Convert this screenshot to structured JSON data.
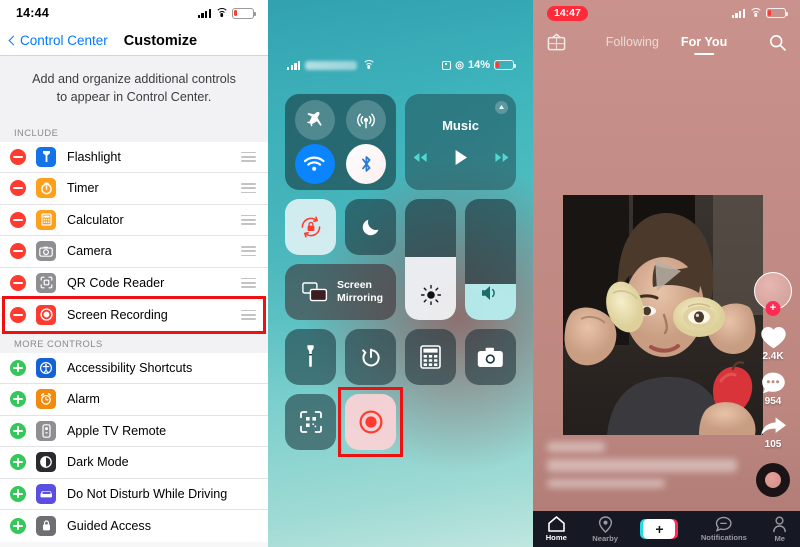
{
  "settings_panel": {
    "status_bar": {
      "time": "14:44",
      "battery_level_pct": 14,
      "signal_icon": "signal-bars-icon",
      "wifi_icon": "wifi-icon",
      "battery_icon": "battery-low-icon"
    },
    "nav": {
      "back_label": "Control Center",
      "title": "Customize",
      "back_icon": "chevron-left-icon"
    },
    "description": "Add and organize additional controls to appear in Control Center.",
    "include_header": "INCLUDE",
    "more_header": "MORE CONTROLS",
    "include_items": [
      {
        "label": "Flashlight",
        "icon": "flashlight-icon",
        "icon_color": "#1473e6",
        "glyph": "▌",
        "action_icon": "remove-icon",
        "highlighted": false
      },
      {
        "label": "Timer",
        "icon": "timer-icon",
        "icon_color": "#ffa01c",
        "glyph": "◴",
        "action_icon": "remove-icon",
        "highlighted": false
      },
      {
        "label": "Calculator",
        "icon": "calculator-icon",
        "icon_color": "#ffa01c",
        "glyph": "⌸",
        "action_icon": "remove-icon",
        "highlighted": false
      },
      {
        "label": "Camera",
        "icon": "camera-icon",
        "icon_color": "#8e8e93",
        "glyph": "◎",
        "action_icon": "remove-icon",
        "highlighted": false
      },
      {
        "label": "QR Code Reader",
        "icon": "qr-code-icon",
        "icon_color": "#8e8e93",
        "glyph": "⬚",
        "action_icon": "remove-icon",
        "highlighted": false
      },
      {
        "label": "Screen Recording",
        "icon": "record-icon",
        "icon_color": "#ff3b30",
        "glyph": "◉",
        "action_icon": "remove-icon",
        "highlighted": true
      }
    ],
    "more_items": [
      {
        "label": "Accessibility Shortcuts",
        "icon": "accessibility-icon",
        "icon_color": "#1463d6",
        "glyph": "Ⓙ",
        "action_icon": "add-icon"
      },
      {
        "label": "Alarm",
        "icon": "alarm-clock-icon",
        "icon_color": "#f28a0d",
        "glyph": "⏰",
        "action_icon": "add-icon"
      },
      {
        "label": "Apple TV Remote",
        "icon": "tv-remote-icon",
        "icon_color": "#8e8e93",
        "glyph": "▯",
        "action_icon": "add-icon"
      },
      {
        "label": "Dark Mode",
        "icon": "dark-mode-icon",
        "icon_color": "#2a2a2e",
        "glyph": "◐",
        "action_icon": "add-icon"
      },
      {
        "label": "Do Not Disturb While Driving",
        "icon": "car-icon",
        "icon_color": "#5a4fe0",
        "glyph": "⛟",
        "action_icon": "add-icon"
      },
      {
        "label": "Guided Access",
        "icon": "guided-access-icon",
        "icon_color": "#6e6e73",
        "glyph": "▮",
        "action_icon": "add-icon"
      }
    ],
    "highlight_color": "#ee1111"
  },
  "control_center_panel": {
    "status_bar": {
      "carrier": "",
      "battery_text": "14%",
      "battery_level_pct": 14,
      "alarm_icon": "alarm-icon",
      "location_icon": "location-icon"
    },
    "connectivity": {
      "airplane": {
        "label": "Airplane Mode",
        "icon": "airplane-icon",
        "state": "off"
      },
      "cellular": {
        "label": "Cellular Data",
        "icon": "cellular-icon",
        "state": "off"
      },
      "wifi": {
        "label": "Wi-Fi",
        "icon": "wifi-icon",
        "state": "on"
      },
      "bluetooth": {
        "label": "Bluetooth",
        "icon": "bluetooth-icon",
        "state": "on"
      }
    },
    "music": {
      "title": "Music",
      "prev_icon": "rewind-icon",
      "play_icon": "play-icon",
      "next_icon": "fast-forward-icon",
      "airplay_icon": "airplay-icon"
    },
    "rotation_lock": {
      "label": "Rotation Lock",
      "icon": "rotation-lock-icon",
      "state": "on"
    },
    "do_not_disturb": {
      "label": "Do Not Disturb",
      "icon": "moon-icon",
      "state": "off"
    },
    "screen_mirroring": {
      "label": "Screen\nMirroring",
      "line1": "Screen",
      "line2": "Mirroring",
      "icon": "screen-mirroring-icon"
    },
    "brightness": {
      "label": "Brightness",
      "icon": "brightness-icon",
      "value_pct": 52
    },
    "volume": {
      "label": "Volume",
      "icon": "volume-icon",
      "value_pct": 30
    },
    "bottom_tiles": [
      {
        "label": "Flashlight",
        "icon": "flashlight-icon"
      },
      {
        "label": "Timer",
        "icon": "timer-icon"
      },
      {
        "label": "Calculator",
        "icon": "calculator-icon"
      },
      {
        "label": "Camera",
        "icon": "camera-icon"
      },
      {
        "label": "QR Code Reader",
        "icon": "qr-code-icon"
      }
    ],
    "screen_recording": {
      "label": "Screen Recording",
      "icon": "record-icon",
      "highlighted": true
    },
    "highlight_color": "#ee1111"
  },
  "tiktok_panel": {
    "status_bar": {
      "time": "14:47",
      "time_pill_color": "#ff2b38",
      "battery_level_pct": 14
    },
    "header": {
      "live_icon": "live-tv-icon",
      "tabs": [
        {
          "label": "Following",
          "active": false
        },
        {
          "label": "For You",
          "active": true
        }
      ],
      "search_icon": "search-icon"
    },
    "actions": {
      "avatar_icon": "avatar-icon",
      "follow_icon": "plus-icon",
      "like": {
        "icon": "heart-icon",
        "count": "2.4K"
      },
      "comment": {
        "icon": "comment-icon",
        "count": "954"
      },
      "share": {
        "icon": "share-arrow-icon",
        "count": "105"
      },
      "music_disc_icon": "music-disc-icon"
    },
    "caption": {
      "redacted": true,
      "lines": 3
    },
    "bottom_nav": [
      {
        "label": "Home",
        "icon": "home-icon",
        "active": true
      },
      {
        "label": "Nearby",
        "icon": "location-pin-icon",
        "active": false
      },
      {
        "label": "+",
        "icon": "create-post-icon",
        "active": false
      },
      {
        "label": "Notifications",
        "icon": "message-icon",
        "active": false
      },
      {
        "label": "Me",
        "icon": "profile-icon",
        "active": false
      }
    ]
  }
}
